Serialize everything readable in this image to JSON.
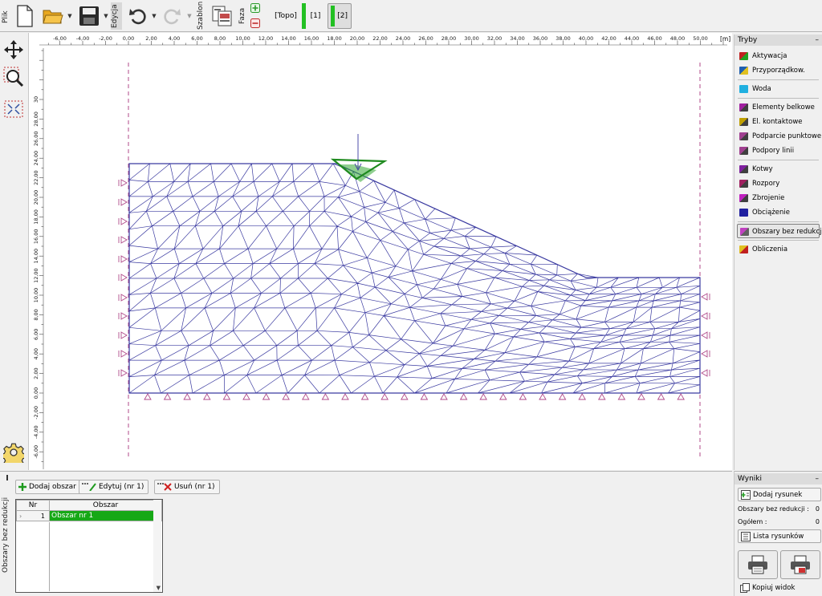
{
  "toolbar": {
    "file_label": "Plik",
    "edit_label": "Edycja",
    "template_label": "Szablon",
    "stage_label": "Faza",
    "stages": [
      "[Topo]",
      "[1]",
      "[2]"
    ],
    "active_stage": "[2]"
  },
  "ruler": {
    "unit": "[m]",
    "x_ticks": [
      "-6,00",
      "-4,00",
      "-2,00",
      "0,00",
      "2,00",
      "4,00",
      "6,00",
      "8,00",
      "10,00",
      "12,00",
      "14,00",
      "16,00",
      "18,00",
      "20,00",
      "22,00",
      "24,00",
      "26,00",
      "28,00",
      "30,00",
      "32,00",
      "34,00",
      "36,00",
      "38,00",
      "40,00",
      "42,00",
      "44,00",
      "46,00",
      "48,00",
      "50,00"
    ],
    "y_ticks": [
      "30",
      "28,00",
      "26,00",
      "24,00",
      "22,00",
      "20,00",
      "18,00",
      "16,00",
      "14,00",
      "12,00",
      "10,00",
      "8,00",
      "6,00",
      "4,00",
      "2,00",
      "0,00",
      "-2,00",
      "-4,00",
      "-6,00"
    ]
  },
  "modes_panel": {
    "title": "Tryby",
    "minimize": "–",
    "groups": [
      [
        {
          "label": "Aktywacja",
          "icon": "activation-icon"
        },
        {
          "label": "Przyporządkow.",
          "icon": "assign-icon"
        }
      ],
      [
        {
          "label": "Woda",
          "icon": "water-icon"
        }
      ],
      [
        {
          "label": "Elementy belkowe",
          "icon": "beam-icon"
        },
        {
          "label": "El. kontaktowe",
          "icon": "contact-icon"
        },
        {
          "label": "Podparcie punktowe",
          "icon": "point-support-icon"
        },
        {
          "label": "Podpory linii",
          "icon": "line-support-icon"
        }
      ],
      [
        {
          "label": "Kotwy",
          "icon": "anchor-icon"
        },
        {
          "label": "Rozpory",
          "icon": "strut-icon"
        },
        {
          "label": "Zbrojenie",
          "icon": "reinforcement-icon"
        },
        {
          "label": "Obciążenie",
          "icon": "load-icon"
        }
      ],
      [
        {
          "label": "Obszary bez redukcji",
          "icon": "no-reduction-icon",
          "active": true
        }
      ],
      [
        {
          "label": "Obliczenia",
          "icon": "analysis-icon"
        }
      ]
    ]
  },
  "bottom": {
    "side_label": "Obszary bez redukcji",
    "add_label": "Dodaj obszar",
    "edit_label": "Edytuj (nr 1)",
    "remove_label": "Usuń (nr 1)",
    "table": {
      "columns": [
        "Nr",
        "Obszar"
      ],
      "rows": [
        {
          "nr": "1",
          "name": "Obszar nr 1"
        }
      ]
    }
  },
  "results": {
    "title": "Wyniki",
    "minimize": "–",
    "add_figure": "Dodaj rysunek",
    "no_reduction_label": "Obszary bez redukcji :",
    "no_reduction_value": "0",
    "total_label": "Ogółem :",
    "total_value": "0",
    "figure_list": "Lista rysunków",
    "copy_view": "Kopiuj widok"
  },
  "colors": {
    "mesh": "#3a3aa0",
    "boundary": "#b04a8a",
    "active_row": "#16a816",
    "load_green": "#1e8a1e",
    "stage_bar": "#22c022"
  }
}
